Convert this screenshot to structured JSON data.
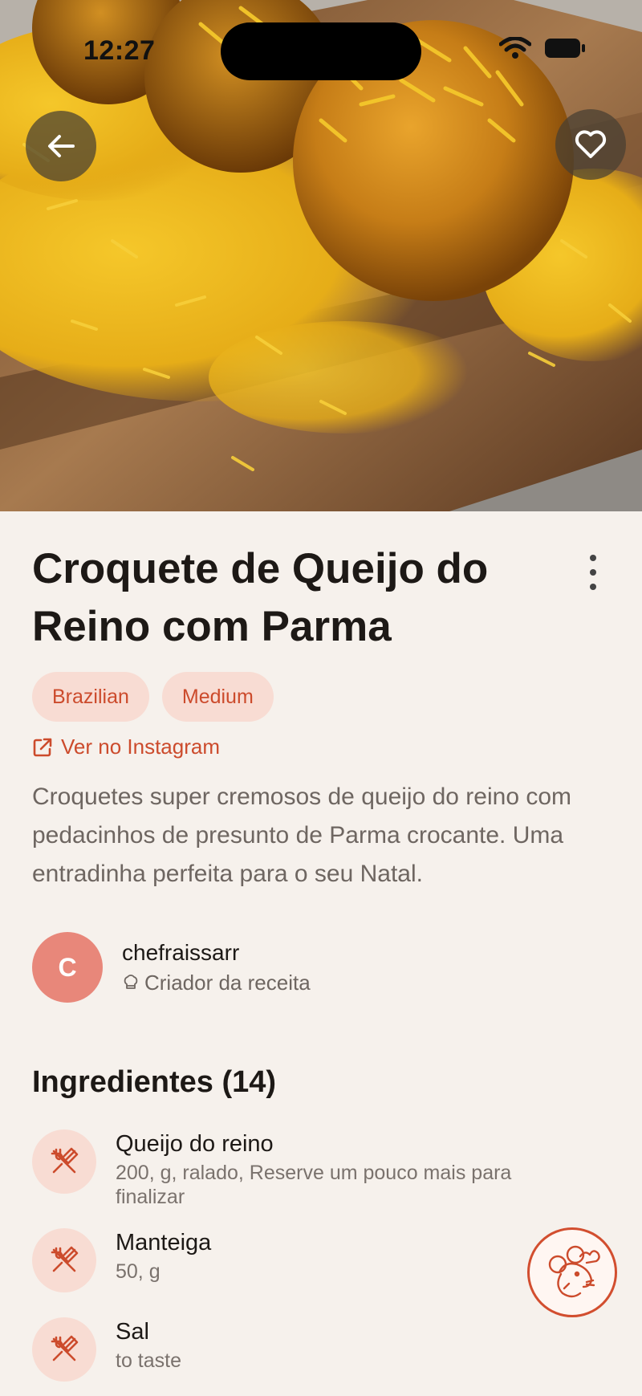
{
  "status_bar": {
    "time": "12:27"
  },
  "header": {
    "back_icon": "arrow-left-icon",
    "favorite_icon": "heart-outline-icon"
  },
  "recipe": {
    "title": "Croquete de Queijo do Reino com Parma",
    "more_icon": "vertical-ellipsis-icon",
    "tags": [
      "Brazilian",
      "Medium"
    ],
    "instagram_link": "Ver no Instagram",
    "description": "Croquetes super cremosos de queijo do reino com pedacinhos de presunto de Parma crocante. Uma entradinha perfeita para o seu Natal."
  },
  "creator": {
    "initial": "C",
    "name": "chefraissarr",
    "role": "Criador da receita"
  },
  "ingredients": {
    "heading": "Ingredientes (14)",
    "items": [
      {
        "name": "Queijo do reino",
        "detail": "200, g, ralado, Reserve um pouco mais para finalizar"
      },
      {
        "name": "Manteiga",
        "detail": "50, g"
      },
      {
        "name": "Sal",
        "detail": "to taste"
      }
    ]
  },
  "colors": {
    "accent": "#cc4b2c",
    "tag_bg": "#f8dcd3",
    "avatar_bg": "#e8877a",
    "page_bg": "#f6f1ec"
  },
  "fab": {
    "icon": "mouse-chef-icon"
  }
}
